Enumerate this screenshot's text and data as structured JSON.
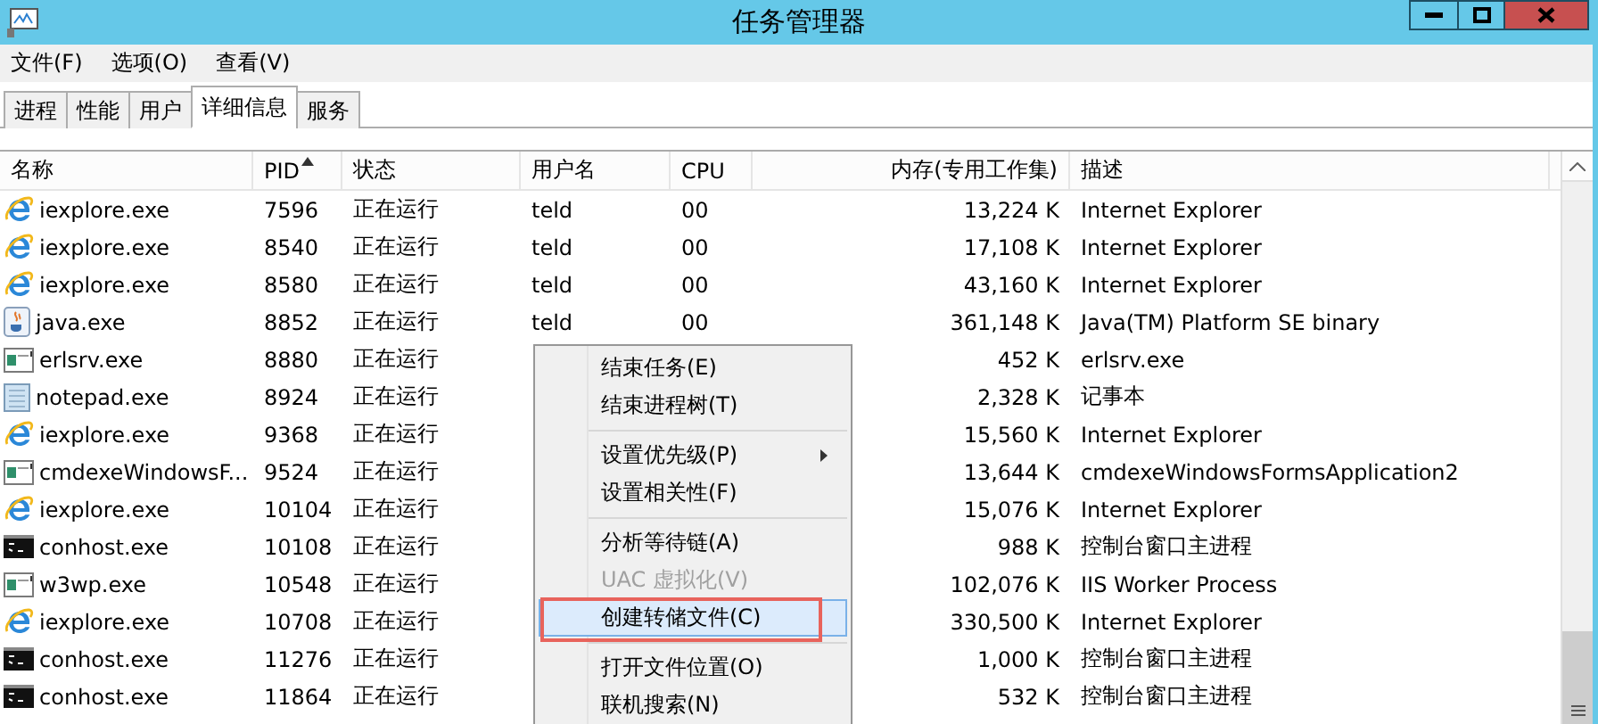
{
  "window": {
    "title": "任务管理器"
  },
  "menu_bar": [
    "文件(F)",
    "选项(O)",
    "查看(V)"
  ],
  "tabs": [
    {
      "label": "进程",
      "selected": false
    },
    {
      "label": "性能",
      "selected": false
    },
    {
      "label": "用户",
      "selected": false
    },
    {
      "label": "详细信息",
      "selected": true
    },
    {
      "label": "服务",
      "selected": false
    }
  ],
  "table": {
    "columns": [
      {
        "label": "名称",
        "sorted": false
      },
      {
        "label": "PID",
        "sorted": true
      },
      {
        "label": "状态",
        "sorted": false
      },
      {
        "label": "用户名",
        "sorted": false
      },
      {
        "label": "CPU",
        "sorted": false
      },
      {
        "label": "内存(专用工作集)",
        "sorted": false
      },
      {
        "label": "描述",
        "sorted": false
      }
    ],
    "rows": [
      {
        "kind": "ie",
        "name": "iexplore.exe",
        "pid": "7596",
        "status": "正在运行",
        "user": "teld",
        "cpu": "00",
        "memory": "13,224 K",
        "description": "Internet Explorer"
      },
      {
        "kind": "ie",
        "name": "iexplore.exe",
        "pid": "8540",
        "status": "正在运行",
        "user": "teld",
        "cpu": "00",
        "memory": "17,108 K",
        "description": "Internet Explorer"
      },
      {
        "kind": "ie",
        "name": "iexplore.exe",
        "pid": "8580",
        "status": "正在运行",
        "user": "teld",
        "cpu": "00",
        "memory": "43,160 K",
        "description": "Internet Explorer"
      },
      {
        "kind": "java",
        "name": "java.exe",
        "pid": "8852",
        "status": "正在运行",
        "user": "teld",
        "cpu": "00",
        "memory": "361,148 K",
        "description": "Java(TM) Platform SE binary"
      },
      {
        "kind": "app",
        "name": "erlsrv.exe",
        "pid": "8880",
        "status": "正在运行",
        "memory": "452 K",
        "description": "erlsrv.exe"
      },
      {
        "kind": "notepad",
        "name": "notepad.exe",
        "pid": "8924",
        "status": "正在运行",
        "memory": "2,328 K",
        "description": "记事本"
      },
      {
        "kind": "ie",
        "name": "iexplore.exe",
        "pid": "9368",
        "status": "正在运行",
        "memory": "15,560 K",
        "description": "Internet Explorer"
      },
      {
        "kind": "app",
        "name": "cmdexeWindowsF...",
        "pid": "9524",
        "status": "正在运行",
        "memory": "13,644 K",
        "description": "cmdexeWindowsFormsApplication2"
      },
      {
        "kind": "ie",
        "name": "iexplore.exe",
        "pid": "10104",
        "status": "正在运行",
        "memory": "15,076 K",
        "description": "Internet Explorer"
      },
      {
        "kind": "console",
        "name": "conhost.exe",
        "pid": "10108",
        "status": "正在运行",
        "memory": "988 K",
        "description": "控制台窗口主进程"
      },
      {
        "kind": "app",
        "name": "w3wp.exe",
        "pid": "10548",
        "status": "正在运行",
        "memory": "102,076 K",
        "description": "IIS Worker Process"
      },
      {
        "kind": "ie",
        "name": "iexplore.exe",
        "pid": "10708",
        "status": "正在运行",
        "memory": "330,500 K",
        "description": "Internet Explorer"
      },
      {
        "kind": "console",
        "name": "conhost.exe",
        "pid": "11276",
        "status": "正在运行",
        "memory": "1,000 K",
        "description": "控制台窗口主进程"
      },
      {
        "kind": "console",
        "name": "conhost.exe",
        "pid": "11864",
        "status": "正在运行",
        "memory": "532 K",
        "description": "控制台窗口主进程"
      }
    ]
  },
  "context_menu": [
    {
      "kind": "item",
      "label": "结束任务(E)",
      "disabled": false,
      "selected": false,
      "submenu": false,
      "annotated": false
    },
    {
      "kind": "item",
      "label": "结束进程树(T)",
      "disabled": false,
      "selected": false,
      "submenu": false,
      "annotated": false
    },
    {
      "kind": "separator"
    },
    {
      "kind": "item",
      "label": "设置优先级(P)",
      "disabled": false,
      "selected": false,
      "submenu": true,
      "annotated": false
    },
    {
      "kind": "item",
      "label": "设置相关性(F)",
      "disabled": false,
      "selected": false,
      "submenu": false,
      "annotated": false
    },
    {
      "kind": "separator"
    },
    {
      "kind": "item",
      "label": "分析等待链(A)",
      "disabled": false,
      "selected": false,
      "submenu": false,
      "annotated": false
    },
    {
      "kind": "item",
      "label": "UAC 虚拟化(V)",
      "disabled": true,
      "selected": false,
      "submenu": false,
      "annotated": false
    },
    {
      "kind": "item",
      "label": "创建转储文件(C)",
      "disabled": false,
      "selected": true,
      "submenu": false,
      "annotated": true
    },
    {
      "kind": "separator"
    },
    {
      "kind": "item",
      "label": "打开文件位置(O)",
      "disabled": false,
      "selected": false,
      "submenu": false,
      "annotated": false
    },
    {
      "kind": "item",
      "label": "联机搜索(N)",
      "disabled": false,
      "selected": false,
      "submenu": false,
      "annotated": false
    }
  ]
}
